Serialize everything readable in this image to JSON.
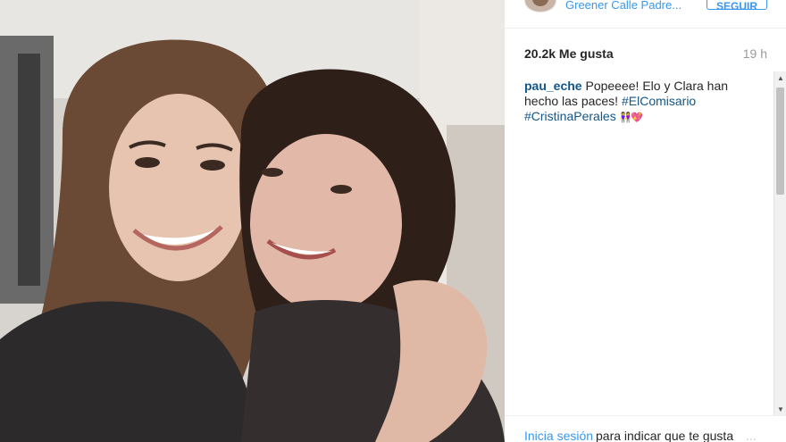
{
  "post": {
    "location": "Greener Calle Padre...",
    "follow_label": "SEGUIR",
    "likes": "20.2k Me gusta",
    "time": "19 h",
    "caption": {
      "username": "pau_eche",
      "text_1": " Popeeee! Elo y Clara han hecho las paces! ",
      "hashtag_1": "#ElComisario",
      "hashtag_2": "#CristinaPerales",
      "emoji": "👭💖"
    },
    "login_link": "Inicia sesión",
    "login_text": " para indicar que te gusta",
    "more": "..."
  },
  "photo": {
    "description_icon": "selfie-photo"
  }
}
